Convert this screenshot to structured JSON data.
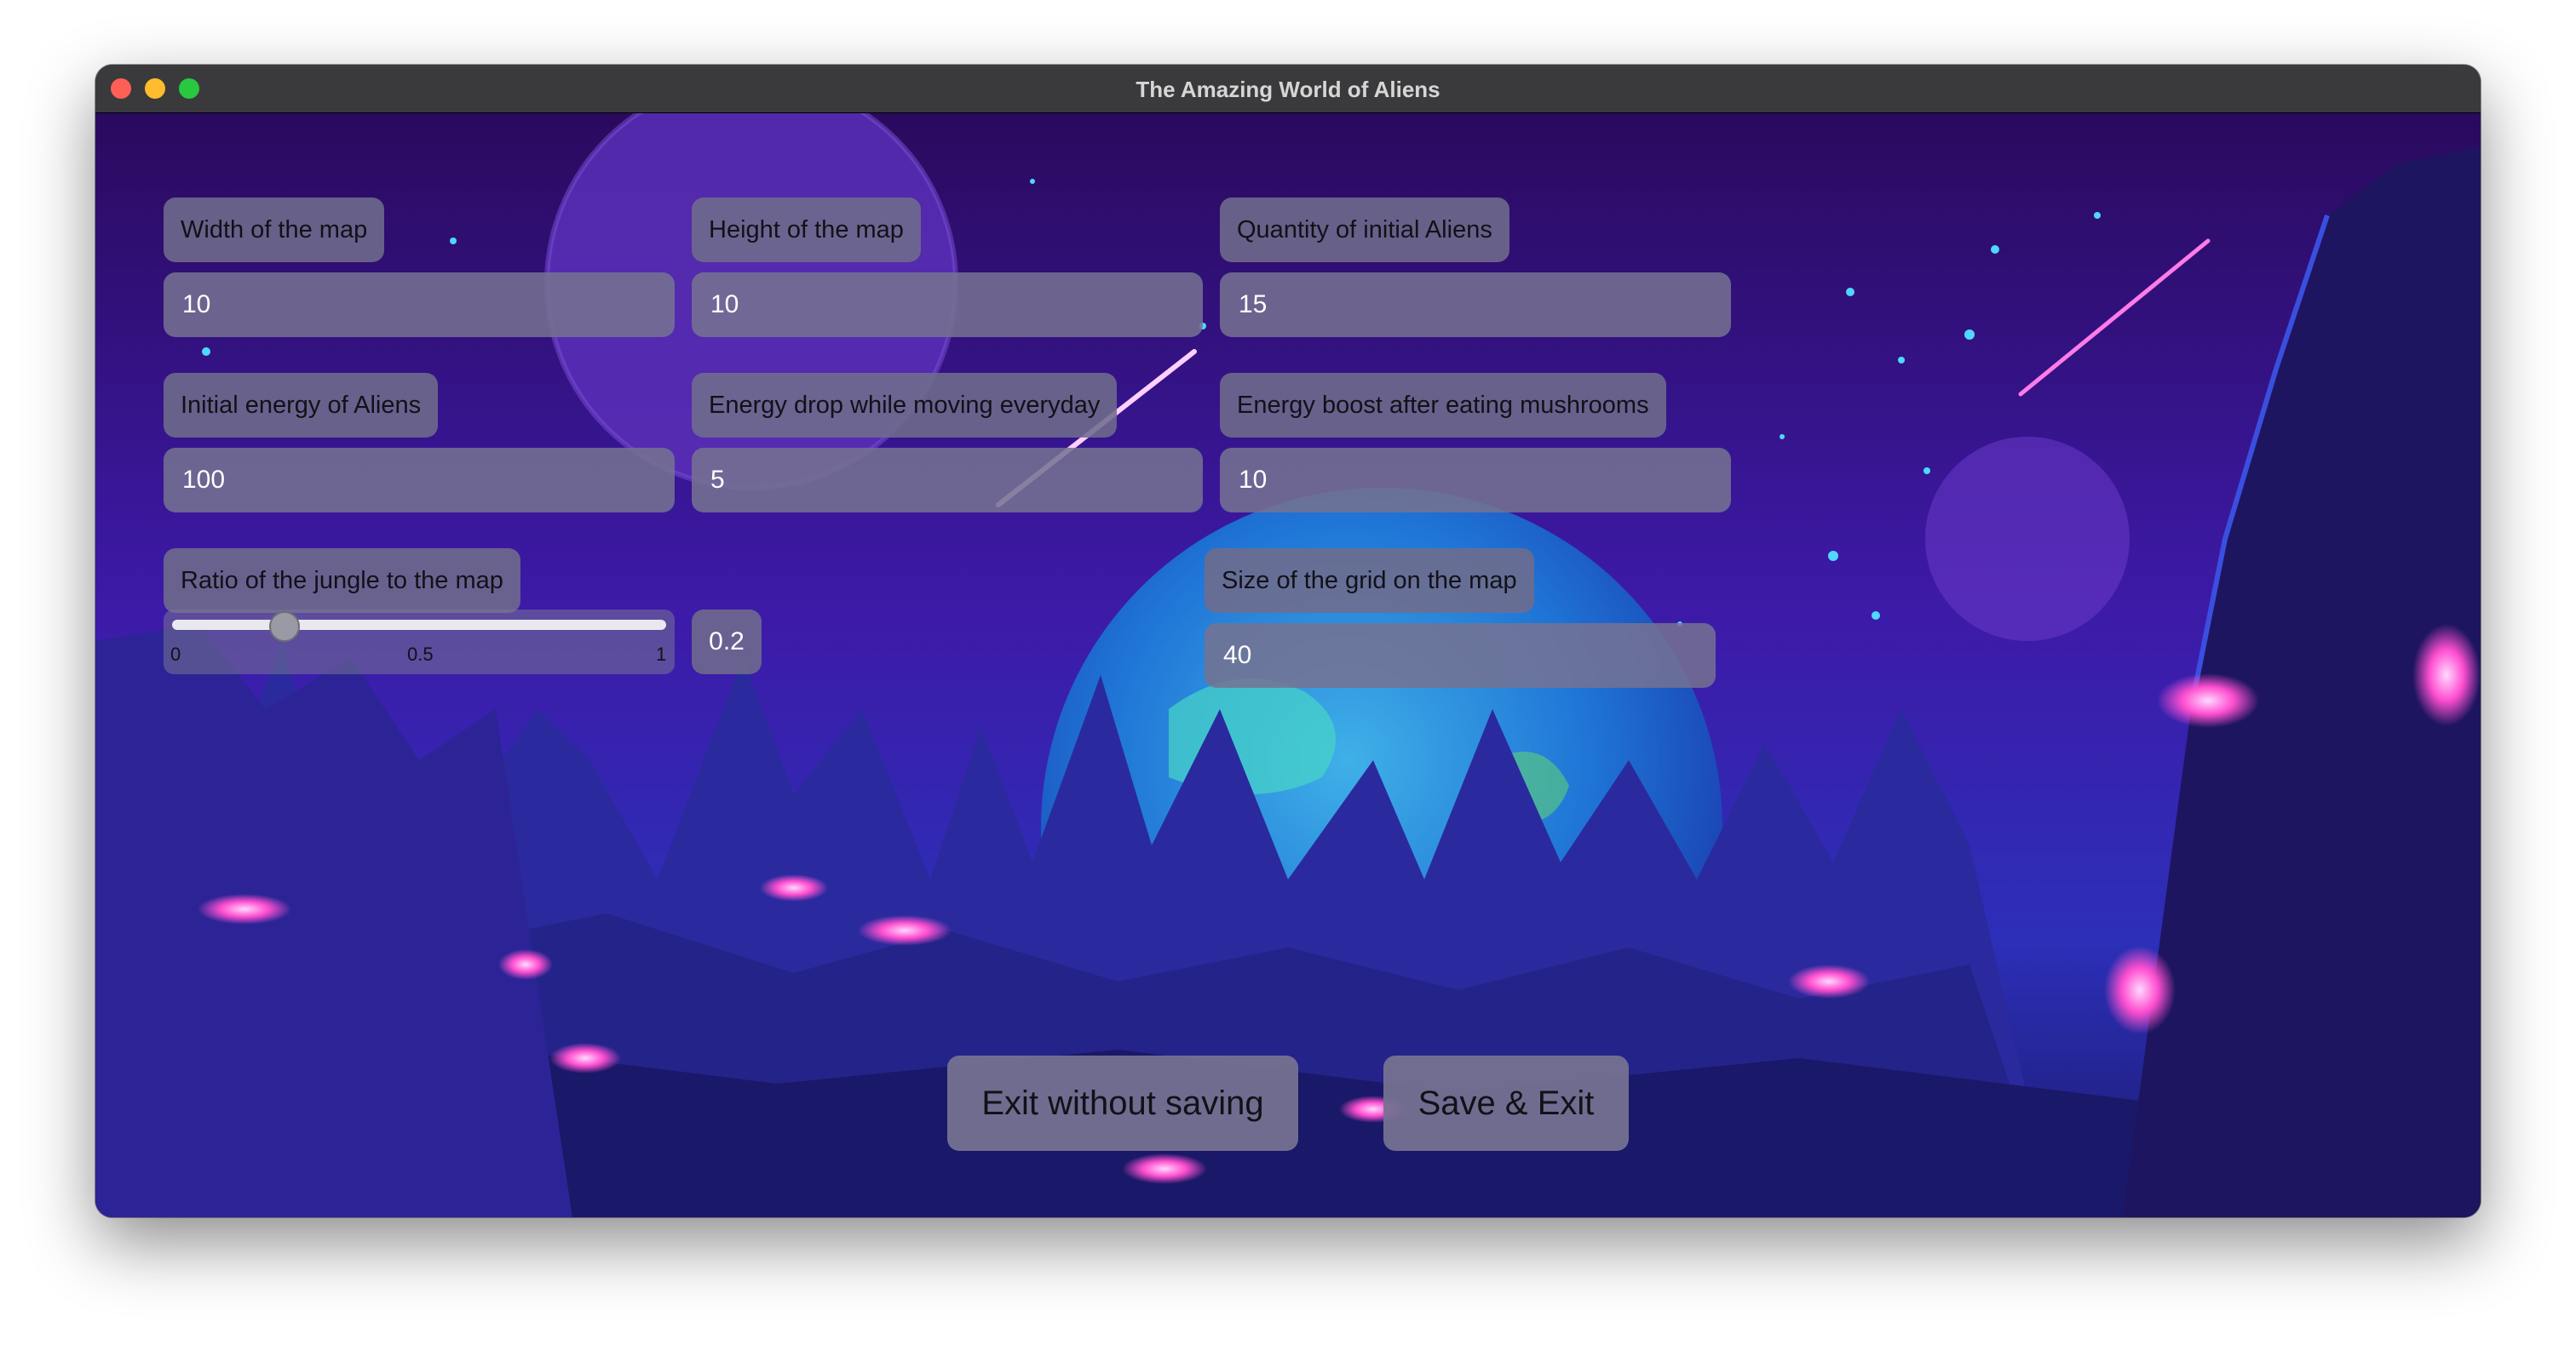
{
  "window": {
    "title": "The Amazing World of Aliens"
  },
  "fields": {
    "width": {
      "label": "Width of the map",
      "value": "10"
    },
    "height": {
      "label": "Height of the map",
      "value": "10"
    },
    "aliens": {
      "label": "Quantity of initial Aliens",
      "value": "15"
    },
    "energy": {
      "label": "Initial energy of Aliens",
      "value": "100"
    },
    "drop": {
      "label": "Energy drop while moving everyday",
      "value": "5"
    },
    "boost": {
      "label": "Energy boost after eating mushrooms",
      "value": "10"
    },
    "grid": {
      "label": "Size of the grid on the map",
      "value": "40"
    }
  },
  "jungle": {
    "label": "Ratio of the jungle to the map",
    "value": 0.2,
    "value_text": "0.2",
    "min": 0,
    "max": 1,
    "ticks": [
      "0",
      "0.5",
      "1"
    ]
  },
  "buttons": {
    "exit_label": "Exit without saving",
    "save_label": "Save & Exit"
  },
  "icons": {
    "close": "close-traffic-light",
    "minimize": "minimize-traffic-light",
    "maximize": "maximize-traffic-light"
  }
}
